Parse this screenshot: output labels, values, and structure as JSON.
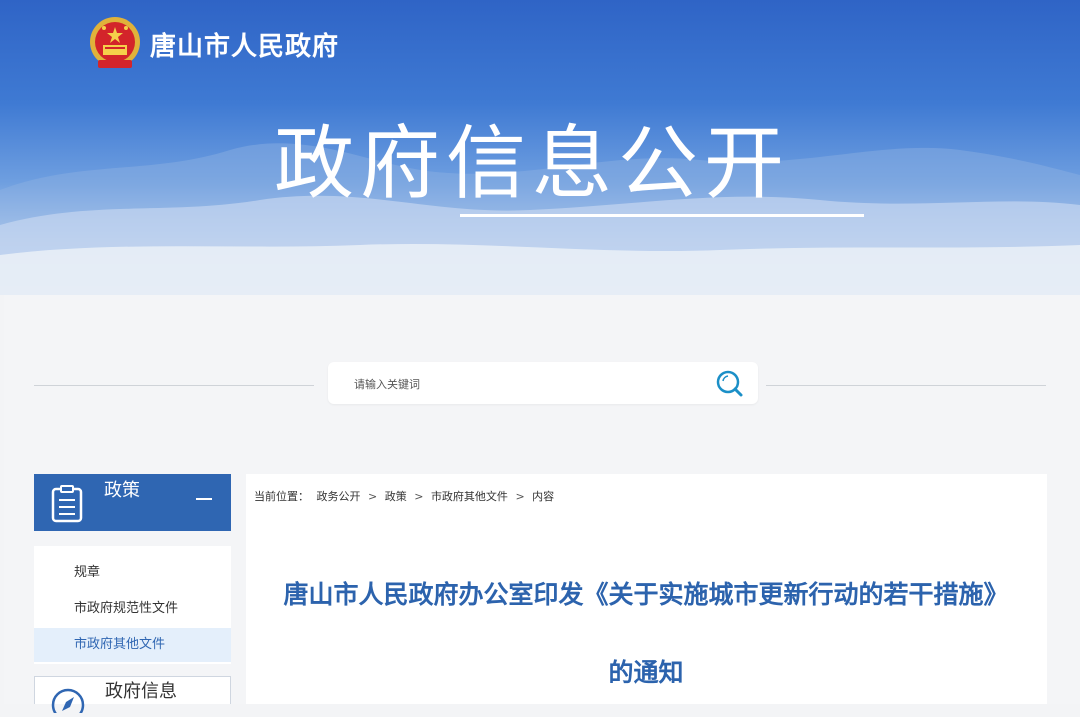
{
  "header": {
    "site_name": "唐山市人民政府",
    "hero_title": "政府信息公开"
  },
  "search": {
    "placeholder": "请输入关键词",
    "icon": "search-icon"
  },
  "sidebar": {
    "section1": {
      "label": "政策",
      "icon": "clipboard-icon",
      "toggle": "collapse-icon"
    },
    "items": [
      {
        "label": "规章"
      },
      {
        "label": "市政府规范性文件"
      },
      {
        "label": "市政府其他文件"
      }
    ],
    "section2": {
      "label": "政府信息",
      "icon": "compass-icon"
    }
  },
  "breadcrumb": {
    "prefix": "当前位置：",
    "items": [
      "政务公开",
      "政策",
      "市政府其他文件",
      "内容"
    ],
    "separator": ">"
  },
  "document": {
    "title": "唐山市人民政府办公室印发《关于实施城市更新行动的若干措施》的通知"
  },
  "colors": {
    "primary": "#2f66b2",
    "title": "#2c63ad",
    "banner_top": "#2f64c6"
  }
}
